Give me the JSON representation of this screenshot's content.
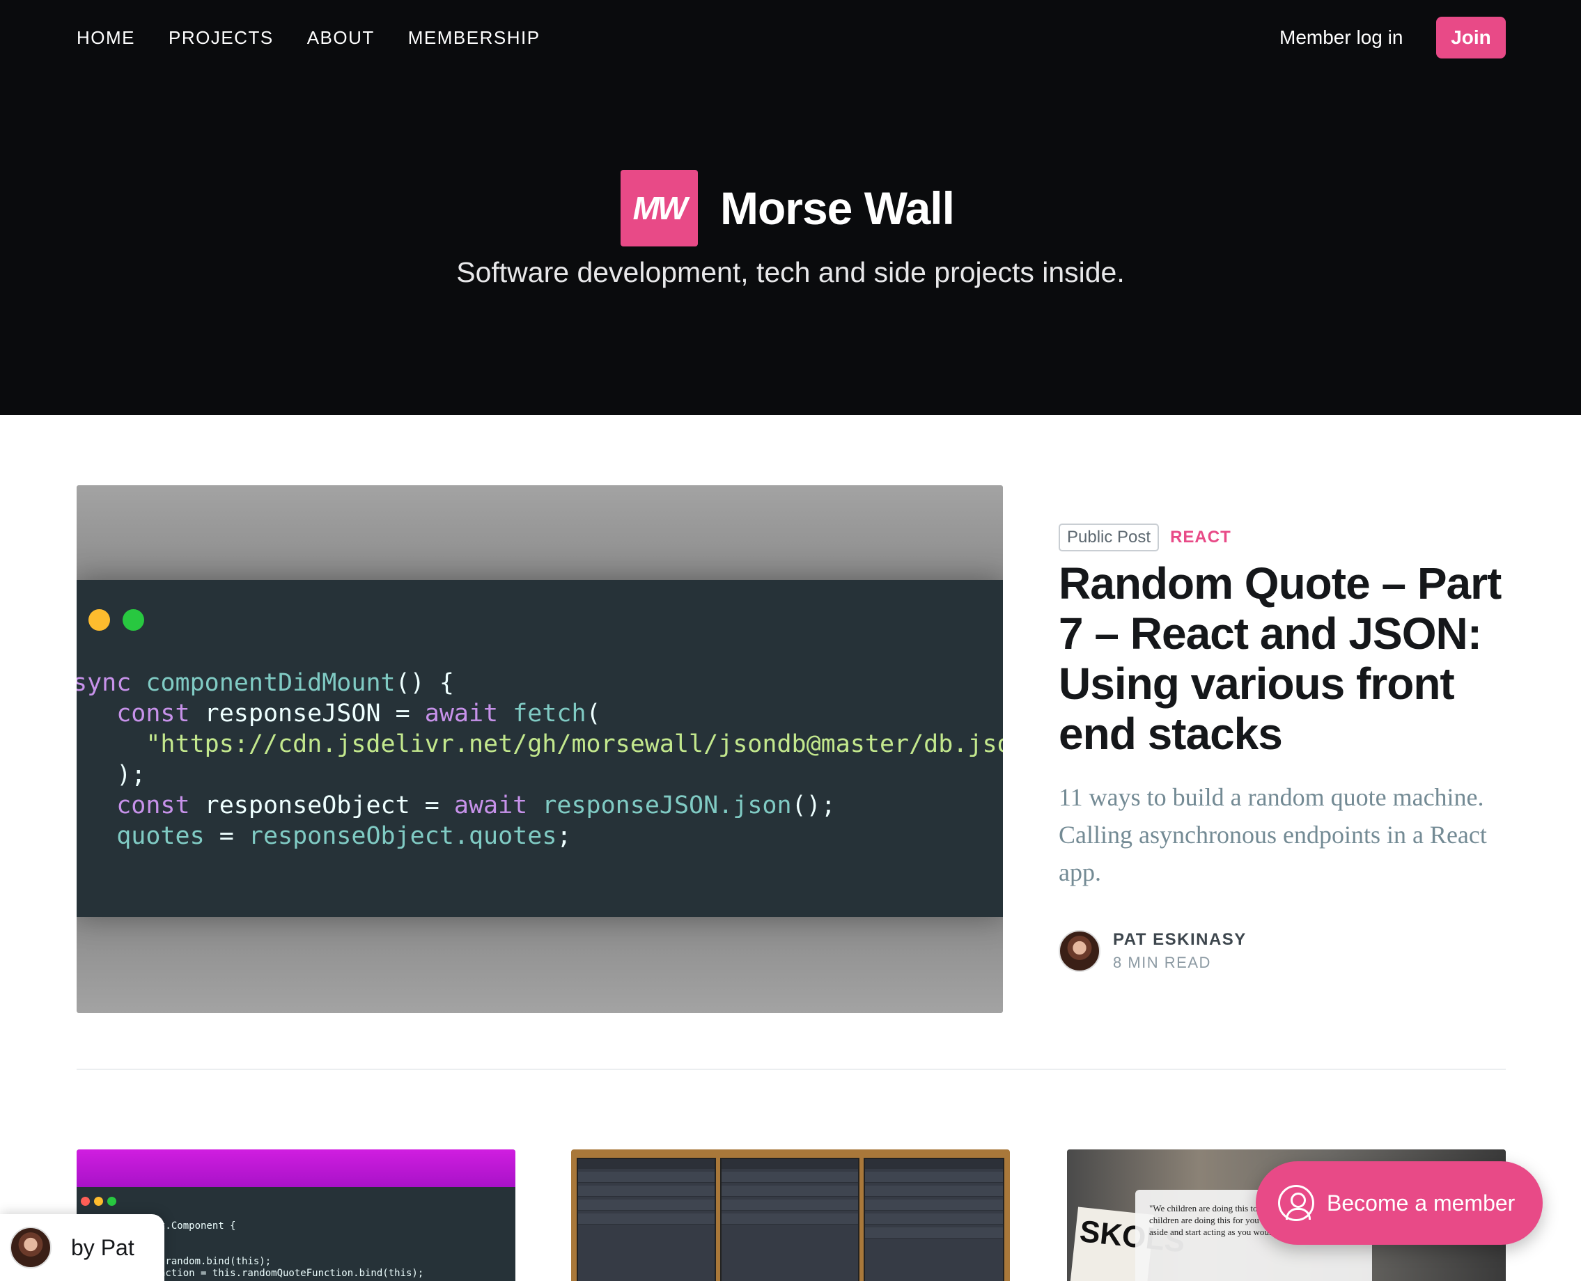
{
  "nav": {
    "items": [
      {
        "label": "HOME"
      },
      {
        "label": "PROJECTS"
      },
      {
        "label": "ABOUT"
      },
      {
        "label": "MEMBERSHIP"
      }
    ],
    "member_login": "Member log in",
    "join": "Join"
  },
  "site": {
    "logo_text": "MW",
    "title": "Morse Wall",
    "description": "Software development, tech and side projects inside."
  },
  "featured": {
    "visibility": "Public Post",
    "tag": "REACT",
    "title": "Random Quote – Part 7 – React and JSON: Using various front end stacks",
    "excerpt": "11 ways to build a random quote machine. Calling asynchronous endpoints in a React app.",
    "author": "PAT ESKINASY",
    "read_time": "8 MIN READ",
    "image_code": {
      "line1_kw": "sync",
      "line1_fn": "componentDidMount",
      "line1_rest": "() {",
      "line2_kw": "const",
      "line2_var": "responseJSON",
      "line2_op": " = ",
      "line2_kw2": "await",
      "line2_fn": "fetch",
      "line2_rest": "(",
      "line3_str": "\"https://cdn.jsdelivr.net/gh/morsewall/jsondb@master/db.json\"",
      "line4": ");",
      "line5_kw": "const",
      "line5_var": "responseObject",
      "line5_op": " = ",
      "line5_kw2": "await",
      "line5_id": "responseJSON",
      "line5_fn": ".json",
      "line5_rest": "();",
      "line6_id": "quotes",
      "line6_op": " = ",
      "line6_id2": "responseObject",
      "line6_fn": ".quotes",
      "line6_rest": ";"
    }
  },
  "cards": {
    "card1_code": "ds React.Component {\nrops) {\n);\n = this.random.bind(this);\nQuoteFunction = this.randomQuoteFunction.bind(this);",
    "card3_sign": "SKOLS",
    "card3_note": "\"We children are doing this to w... the adults up. We children are doing this for you to put your differences aside and start acting as you would"
  },
  "floating": {
    "become_member": "Become a member",
    "by_pat": "by Pat"
  },
  "colors": {
    "accent": "#e84a87",
    "hero_bg": "#0a0b0d",
    "code_bg": "#263238"
  }
}
